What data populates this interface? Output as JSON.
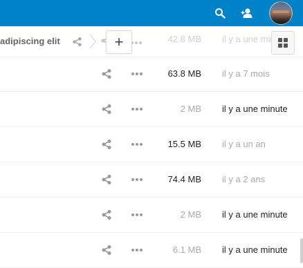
{
  "header": {
    "search_icon": "search-icon",
    "contacts_icon": "contacts-icon",
    "avatar": "user-avatar",
    "bg_color": "#0082c9"
  },
  "breadcrumb": {
    "folder_name": "adipiscing elit",
    "share_icon": "share-icon",
    "separator_icon": "chevron-right-icon"
  },
  "controls": {
    "new_label": "+",
    "view_toggle_icon": "grid-view-icon"
  },
  "background_row": {
    "size": "42.8 MB",
    "date": "il y a une minute"
  },
  "files": [
    {
      "size": "63.8 MB",
      "date": "il y a 7 mois",
      "size_color": "#222222",
      "date_color": "#aaaaaa"
    },
    {
      "size": "2 MB",
      "date": "il y a une minute",
      "size_color": "#aaaaaa",
      "date_color": "#222222"
    },
    {
      "size": "15.5 MB",
      "date": "il y a un an",
      "size_color": "#222222",
      "date_color": "#aaaaaa"
    },
    {
      "size": "74.4 MB",
      "date": "il y a 2 ans",
      "size_color": "#222222",
      "date_color": "#aaaaaa"
    },
    {
      "size": "2 MB",
      "date": "il y a une minute",
      "size_color": "#aaaaaa",
      "date_color": "#222222"
    },
    {
      "size": "6.1 MB",
      "date": "il y a une minute",
      "size_color": "#aaaaaa",
      "date_color": "#222222"
    }
  ]
}
